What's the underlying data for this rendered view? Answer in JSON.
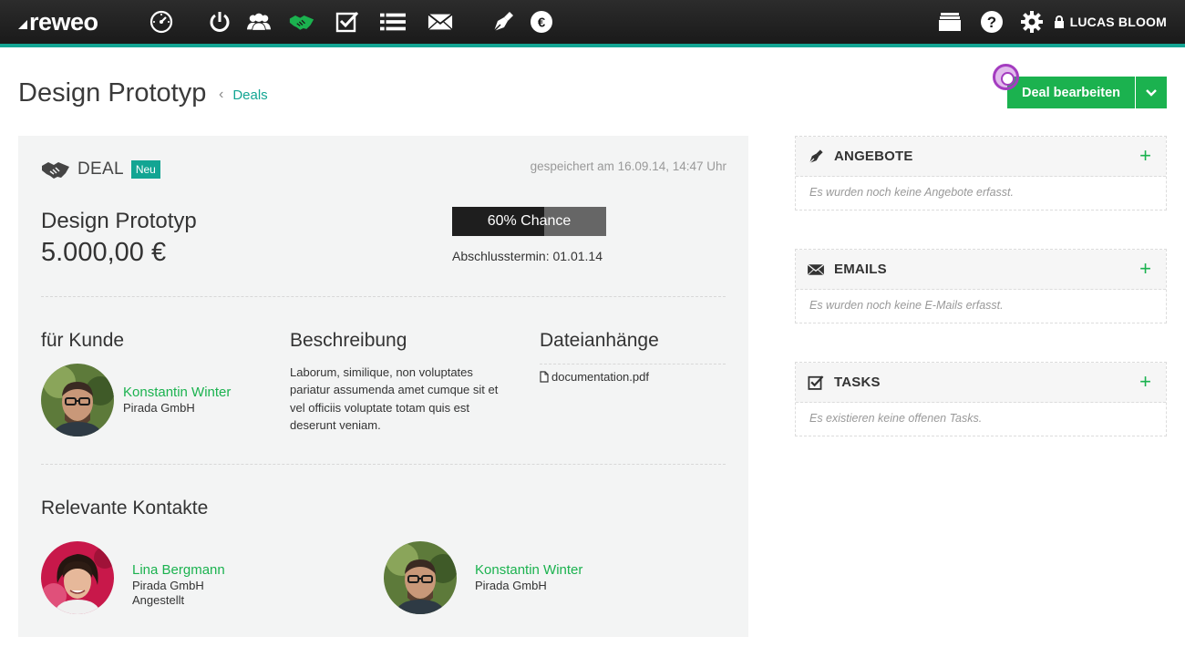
{
  "nav": {
    "logo": "reweo",
    "icons": [
      "dashboard-icon",
      "power-icon",
      "contacts-icon",
      "deals-icon",
      "tasks-icon",
      "list-icon",
      "mail-icon",
      "offers-pen-icon",
      "finance-euro-icon"
    ],
    "right_icons": [
      "folder-icon",
      "help-icon",
      "settings-icon"
    ],
    "user": "LUCAS BLOOM",
    "accent": "#13a593"
  },
  "header": {
    "title": "Design Prototyp",
    "breadcrumb": "Deals",
    "edit_button": "Deal bearbeiten",
    "button_color": "#1bb24f"
  },
  "deal": {
    "label": "DEAL",
    "badge": "Neu",
    "saved": "gespeichert am 16.09.14, 14:47 Uhr",
    "name": "Design Prototyp",
    "amount": "5.000,00 €",
    "chance_text": "60% Chance",
    "chance_percent": 60,
    "close_date": "Abschlusstermin: 01.01.14",
    "customer": {
      "heading": "für Kunde",
      "name": "Konstantin Winter",
      "company": "Pirada GmbH"
    },
    "description": {
      "heading": "Beschreibung",
      "text": "Laborum, similique, non voluptates pariatur assumenda amet cumque sit et vel officiis voluptate totam quis est deserunt veniam."
    },
    "attachments": {
      "heading": "Dateianhänge",
      "files": [
        "documentation.pdf"
      ]
    },
    "related": {
      "heading": "Relevante Kontakte",
      "contacts": [
        {
          "name": "Lina Bergmann",
          "company": "Pirada GmbH",
          "role": "Angestellt"
        },
        {
          "name": "Konstantin Winter",
          "company": "Pirada GmbH"
        }
      ]
    }
  },
  "widgets": [
    {
      "title": "ANGEBOTE",
      "icon": "pen-icon",
      "empty": "Es wurden noch keine Angebote erfasst."
    },
    {
      "title": "EMAILS",
      "icon": "mail-icon",
      "empty": "Es wurden noch keine E-Mails erfasst."
    },
    {
      "title": "TASKS",
      "icon": "checkbox-icon",
      "empty": "Es existieren keine offenen Tasks."
    }
  ]
}
